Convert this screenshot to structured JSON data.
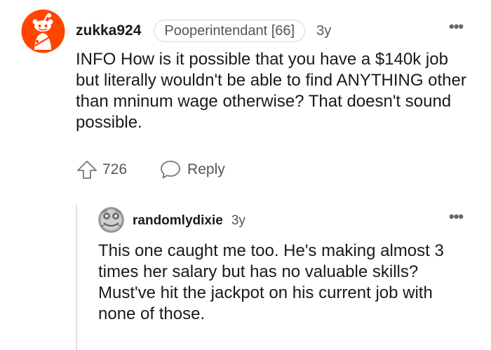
{
  "comment": {
    "username": "zukka924",
    "flair": "Pooperintendant [66]",
    "age": "3y",
    "body": "INFO How is it possible that you have a $140k job but literally wouldn't be able to find ANYTHING other than mninum wage otherwise? That doesn't sound possible.",
    "votes": "726",
    "reply_label": "Reply",
    "more_icon": "•••"
  },
  "reply": {
    "username": "randomlydixie",
    "age": "3y",
    "body": "This one caught me too. He's making almost 3 times her salary but has no valuable skills? Must've hit the jackpot on his current job with none of those.",
    "more_icon": "•••"
  },
  "colors": {
    "avatar_orange": "#ff4500",
    "text": "#1a1a1b",
    "meta": "#555555"
  }
}
